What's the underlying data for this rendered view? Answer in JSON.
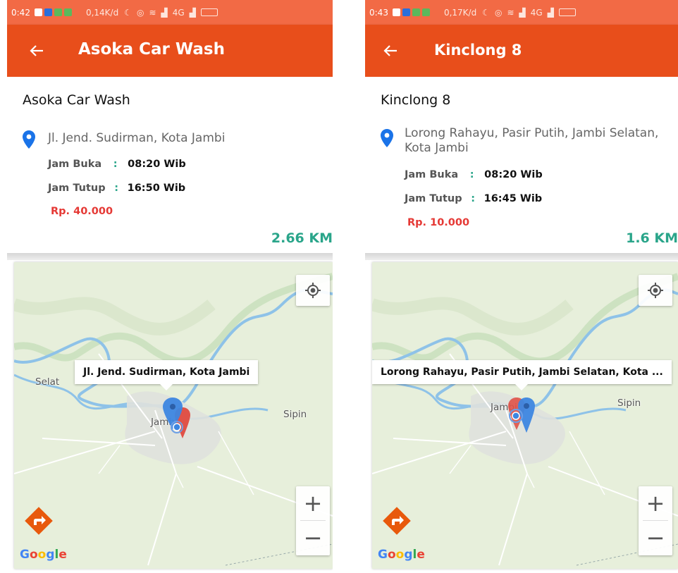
{
  "colors": {
    "statusbar": "#F26A45",
    "appbar": "#E84E1B",
    "price": "#E53935",
    "distance": "#2aa58a",
    "map_bg": "#e7efdb",
    "water": "#8ec2e8"
  },
  "screens": [
    {
      "status": {
        "time": "0:42",
        "net_speed": "0,14K/d",
        "network": "4G"
      },
      "title": "Asoka Car Wash",
      "place": {
        "name": "Asoka Car Wash",
        "address": "Jl. Jend. Sudirman, Kota Jambi",
        "open_label": "Jam Buka",
        "open_value": "08:20 Wib",
        "close_label": "Jam Tutup",
        "close_value": "16:50 Wib",
        "price": "Rp. 40.000",
        "distance": "2.66 KM"
      },
      "map": {
        "info_window": "Jl. Jend. Sudirman, Kota Jambi",
        "labels": [
          "Selat",
          "Jambi",
          "Sipin"
        ],
        "zoom_in": "+",
        "zoom_out": "−",
        "attribution": "Google"
      }
    },
    {
      "status": {
        "time": "0:43",
        "net_speed": "0,17K/d",
        "network": "4G"
      },
      "title": "Kinclong 8",
      "place": {
        "name": "Kinclong 8",
        "address": "Lorong Rahayu, Pasir Putih, Jambi Selatan, Kota Jambi",
        "open_label": "Jam Buka",
        "open_value": "08:20 Wib",
        "close_label": "Jam Tutup",
        "close_value": "16:45 Wib",
        "price": "Rp. 10.000",
        "distance": "1.6 KM"
      },
      "map": {
        "info_window": "Lorong Rahayu, Pasir Putih, Jambi Selatan, Kota ...",
        "labels": [
          "Jambi",
          "Sipin"
        ],
        "zoom_in": "+",
        "zoom_out": "−",
        "attribution": "Google"
      }
    }
  ],
  "icons": {
    "back": "arrow-left-icon",
    "pin": "location-pin-icon",
    "my_location": "my-location-icon",
    "directions": "directions-icon",
    "marker": "map-marker-icon"
  }
}
